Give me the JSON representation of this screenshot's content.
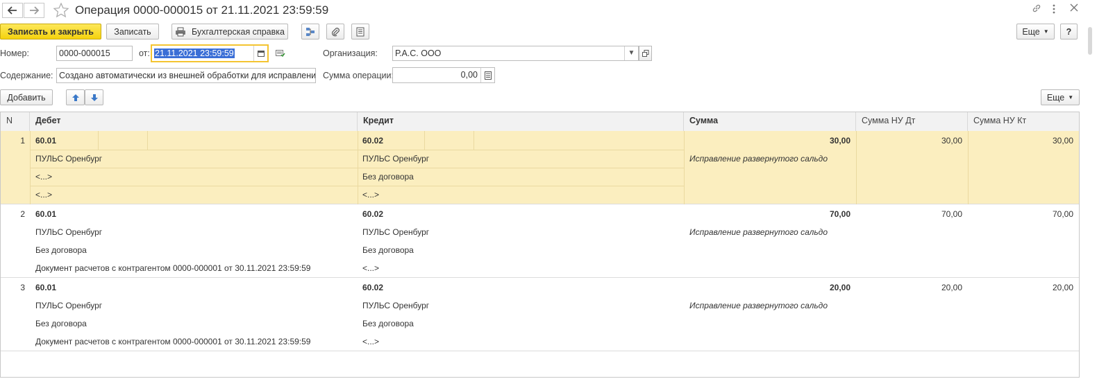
{
  "title": "Операция 0000-000015 от 21.11.2021 23:59:59",
  "toolbar": {
    "save_close": "Записать и закрыть",
    "save": "Записать",
    "report": "Бухгалтерская справка",
    "more": "Еще",
    "help": "?"
  },
  "form": {
    "number_label": "Номер:",
    "number_value": "0000-000015",
    "date_label": "от:",
    "date_value": "21.11.2021 23:59:59",
    "org_label": "Организация:",
    "org_value": "Р.А.С. ООО",
    "content_label": "Содержание:",
    "content_value": "Создано автоматически из внешней обработки для исправления ра",
    "sum_label": "Сумма операции:",
    "sum_value": "0,00"
  },
  "table_toolbar": {
    "add": "Добавить",
    "more": "Еще"
  },
  "table": {
    "headers": {
      "n": "N",
      "debit": "Дебет",
      "credit": "Кредит",
      "sum": "Сумма",
      "sum_nu_dt": "Сумма НУ Дт",
      "sum_nu_kt": "Сумма НУ Кт"
    },
    "rows": [
      {
        "n": "1",
        "debit": [
          "60.01",
          "ПУЛЬС Оренбург",
          "<...>",
          "<...>"
        ],
        "credit": [
          "60.02",
          "ПУЛЬС Оренбург",
          "Без договора",
          "<...>"
        ],
        "sum": "30,00",
        "comment": "Исправление развернутого сальдо",
        "sum_nu_dt": "30,00",
        "sum_nu_kt": "30,00"
      },
      {
        "n": "2",
        "debit": [
          "60.01",
          "ПУЛЬС Оренбург",
          "Без договора",
          "Документ расчетов с контрагентом 0000-000001 от 30.11.2021 23:59:59"
        ],
        "credit": [
          "60.02",
          "ПУЛЬС Оренбург",
          "Без договора",
          "<...>"
        ],
        "sum": "70,00",
        "comment": "Исправление развернутого сальдо",
        "sum_nu_dt": "70,00",
        "sum_nu_kt": "70,00"
      },
      {
        "n": "3",
        "debit": [
          "60.01",
          "ПУЛЬС Оренбург",
          "Без договора",
          "Документ расчетов с контрагентом 0000-000001 от 30.11.2021 23:59:59"
        ],
        "credit": [
          "60.02",
          "ПУЛЬС Оренбург",
          "Без договора",
          "<...>"
        ],
        "sum": "20,00",
        "comment": "Исправление развернутого сальдо",
        "sum_nu_dt": "20,00",
        "sum_nu_kt": "20,00"
      }
    ]
  }
}
